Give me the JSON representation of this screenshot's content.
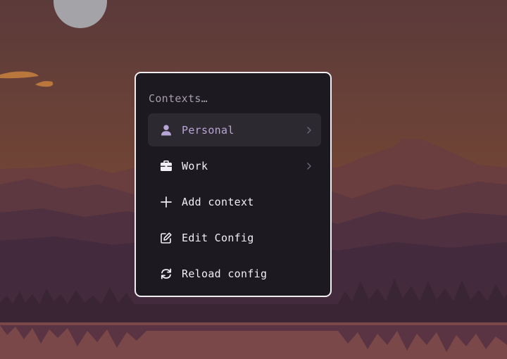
{
  "menu": {
    "title": "Contexts…",
    "items": [
      {
        "label": "Personal",
        "icon": "user-icon",
        "active": true,
        "submenu": true
      },
      {
        "label": "Work",
        "icon": "briefcase-icon",
        "active": false,
        "submenu": true
      },
      {
        "label": "Add context",
        "icon": "plus-icon",
        "active": false,
        "submenu": false
      },
      {
        "label": "Edit Config",
        "icon": "edit-icon",
        "active": false,
        "submenu": false
      },
      {
        "label": "Reload config",
        "icon": "refresh-icon",
        "active": false,
        "submenu": false
      }
    ]
  },
  "colors": {
    "menu_bg": "#1d1921",
    "menu_border": "#f1eef2",
    "active_item_bg": "#2d2931",
    "active_label": "#b8a6d6",
    "label": "#f2eff4",
    "title": "#a59fa8",
    "sky": "#6e4236",
    "sun": "#a4a3a8"
  }
}
